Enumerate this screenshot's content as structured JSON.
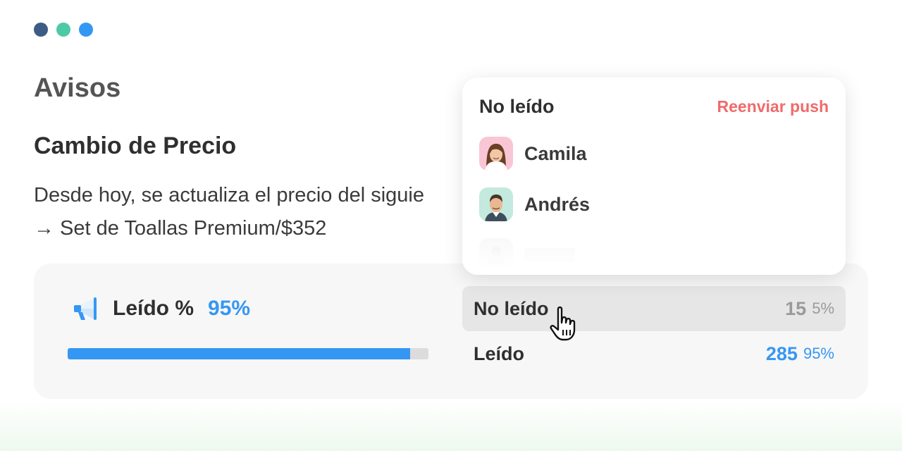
{
  "window": {
    "dots": [
      "#3c5c86",
      "#4ccaa6",
      "#3597f4"
    ]
  },
  "page": {
    "title": "Avisos"
  },
  "notice": {
    "title": "Cambio de Precio",
    "line1": "Desde hoy, se actualiza el precio del siguie",
    "line2": "→ Set de Toallas Premium/$352"
  },
  "stats": {
    "read_label": "Leído %",
    "read_pct": "95%",
    "read_fraction": 0.95,
    "icon": "megaphone-icon",
    "rows": [
      {
        "label": "No leído",
        "count": "15",
        "pct": "5%"
      },
      {
        "label": "Leído",
        "count": "285",
        "pct": "95%"
      }
    ]
  },
  "popover": {
    "title": "No leído",
    "action": "Reenviar push",
    "users": [
      {
        "name": "Camila",
        "avatar_bg": "#f9c6d6"
      },
      {
        "name": "Andrés",
        "avatar_bg": "#c4e9de"
      }
    ]
  },
  "colors": {
    "accent": "#3597f4",
    "danger": "#f06a6a",
    "muted": "#9a9a9a"
  }
}
